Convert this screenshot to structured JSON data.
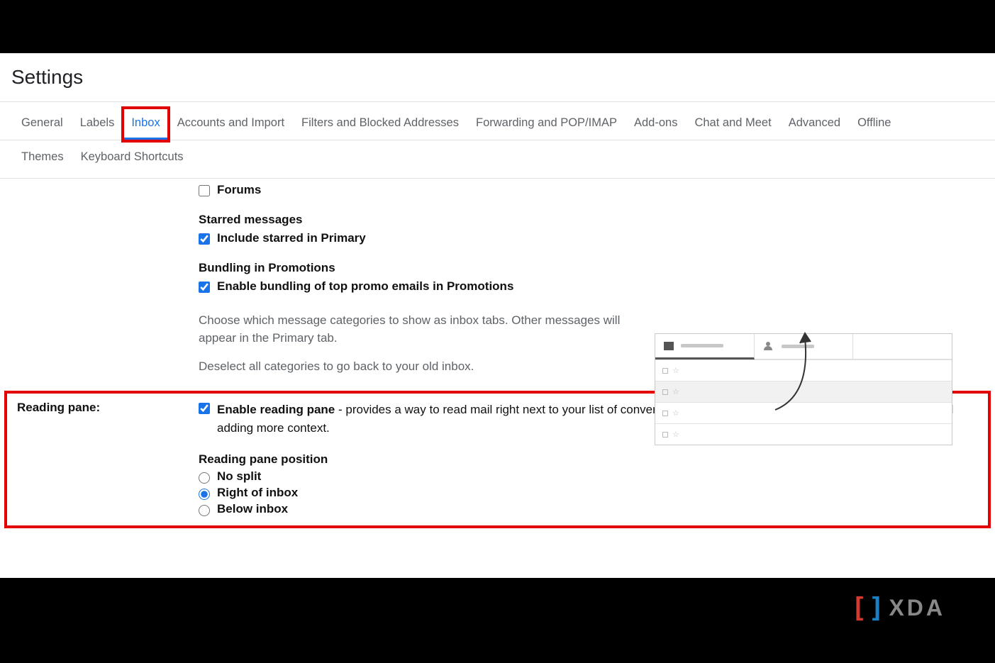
{
  "page_title": "Settings",
  "tabs": {
    "general": "General",
    "labels": "Labels",
    "inbox": "Inbox",
    "accounts": "Accounts and Import",
    "filters": "Filters and Blocked Addresses",
    "forwarding": "Forwarding and POP/IMAP",
    "addons": "Add-ons",
    "chat": "Chat and Meet",
    "advanced": "Advanced",
    "offline": "Offline",
    "themes": "Themes",
    "keyboard": "Keyboard Shortcuts"
  },
  "categories": {
    "forums": {
      "label": "Forums",
      "checked": false
    }
  },
  "starred": {
    "heading": "Starred messages",
    "include": {
      "label": "Include starred in Primary",
      "checked": true
    }
  },
  "bundling": {
    "heading": "Bundling in Promotions",
    "enable": {
      "label": "Enable bundling of top promo emails in Promotions",
      "checked": true
    }
  },
  "category_desc": "Choose which message categories to show as inbox tabs. Other messages will appear in the Primary tab.",
  "deselect_desc": "Deselect all categories to go back to your old inbox.",
  "reading_pane": {
    "section_label": "Reading pane:",
    "enable_label": "Enable reading pane",
    "enable_desc": " - provides a way to read mail right next to your list of conversations, making mail reading and writing mail faster and adding more context.",
    "enable_checked": true,
    "position_heading": "Reading pane position",
    "options": {
      "no_split": {
        "label": "No split",
        "selected": false
      },
      "right": {
        "label": "Right of inbox",
        "selected": true
      },
      "below": {
        "label": "Below inbox",
        "selected": false
      }
    }
  },
  "branding": {
    "text": "XDA"
  }
}
